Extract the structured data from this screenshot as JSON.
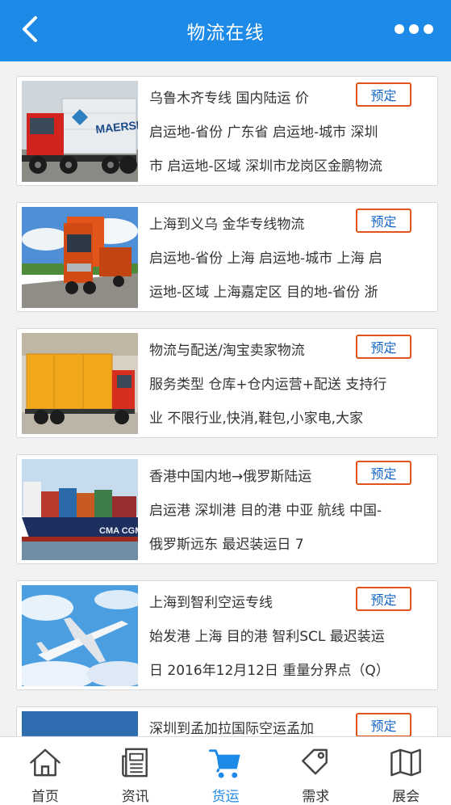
{
  "header": {
    "title": "物流在线",
    "back_icon": "chevron-left-icon",
    "more_icon": "more-dots-icon"
  },
  "listings": [
    {
      "line1": "乌鲁木齐专线 国内陆运 价",
      "line2": "启运地-省份 广东省 启运地-城市 深圳",
      "line3": "市 启运地-区域 深圳市龙岗区金鹏物流",
      "book_label": "预定",
      "image": "container-truck"
    },
    {
      "line1": "上海到义乌 金华专线物流",
      "line2": "启运地-省份 上海 启运地-城市 上海 启",
      "line3": "运地-区域 上海嘉定区 目的地-省份 浙",
      "book_label": "预定",
      "image": "orange-truck-road"
    },
    {
      "line1": "物流与配送/淘宝卖家物流",
      "line2": "服务类型 仓库+仓内运营+配送 支持行",
      "line3": "业 不限行业,快消,鞋包,小家电,大家",
      "book_label": "预定",
      "image": "yellow-box-truck"
    },
    {
      "line1": "香港中国内地→俄罗斯陆运",
      "line2": "启运港 深圳港 目的港 中亚 航线 中国-",
      "line3": "俄罗斯远东 最迟装运日 7",
      "book_label": "预定",
      "image": "container-ship"
    },
    {
      "line1": "上海到智利空运专线",
      "line2": "始发港 上海 目的港 智利SCL 最迟装运",
      "line3": "日 2016年12月12日 重量分界点（Q）",
      "book_label": "预定",
      "image": "airplane-sky"
    },
    {
      "line1": "深圳到孟加拉国际空运孟加",
      "line2": "",
      "line3": "",
      "book_label": "预定",
      "image": "blue-sky"
    }
  ],
  "tabs": [
    {
      "label": "首页",
      "icon": "home-icon",
      "active": false
    },
    {
      "label": "资讯",
      "icon": "news-icon",
      "active": false
    },
    {
      "label": "货运",
      "icon": "cart-icon",
      "active": true
    },
    {
      "label": "需求",
      "icon": "tag-icon",
      "active": false
    },
    {
      "label": "展会",
      "icon": "map-icon",
      "active": false
    }
  ],
  "colors": {
    "primary": "#1e8ae8",
    "book_border": "#e0541c",
    "book_text": "#1666c5"
  }
}
